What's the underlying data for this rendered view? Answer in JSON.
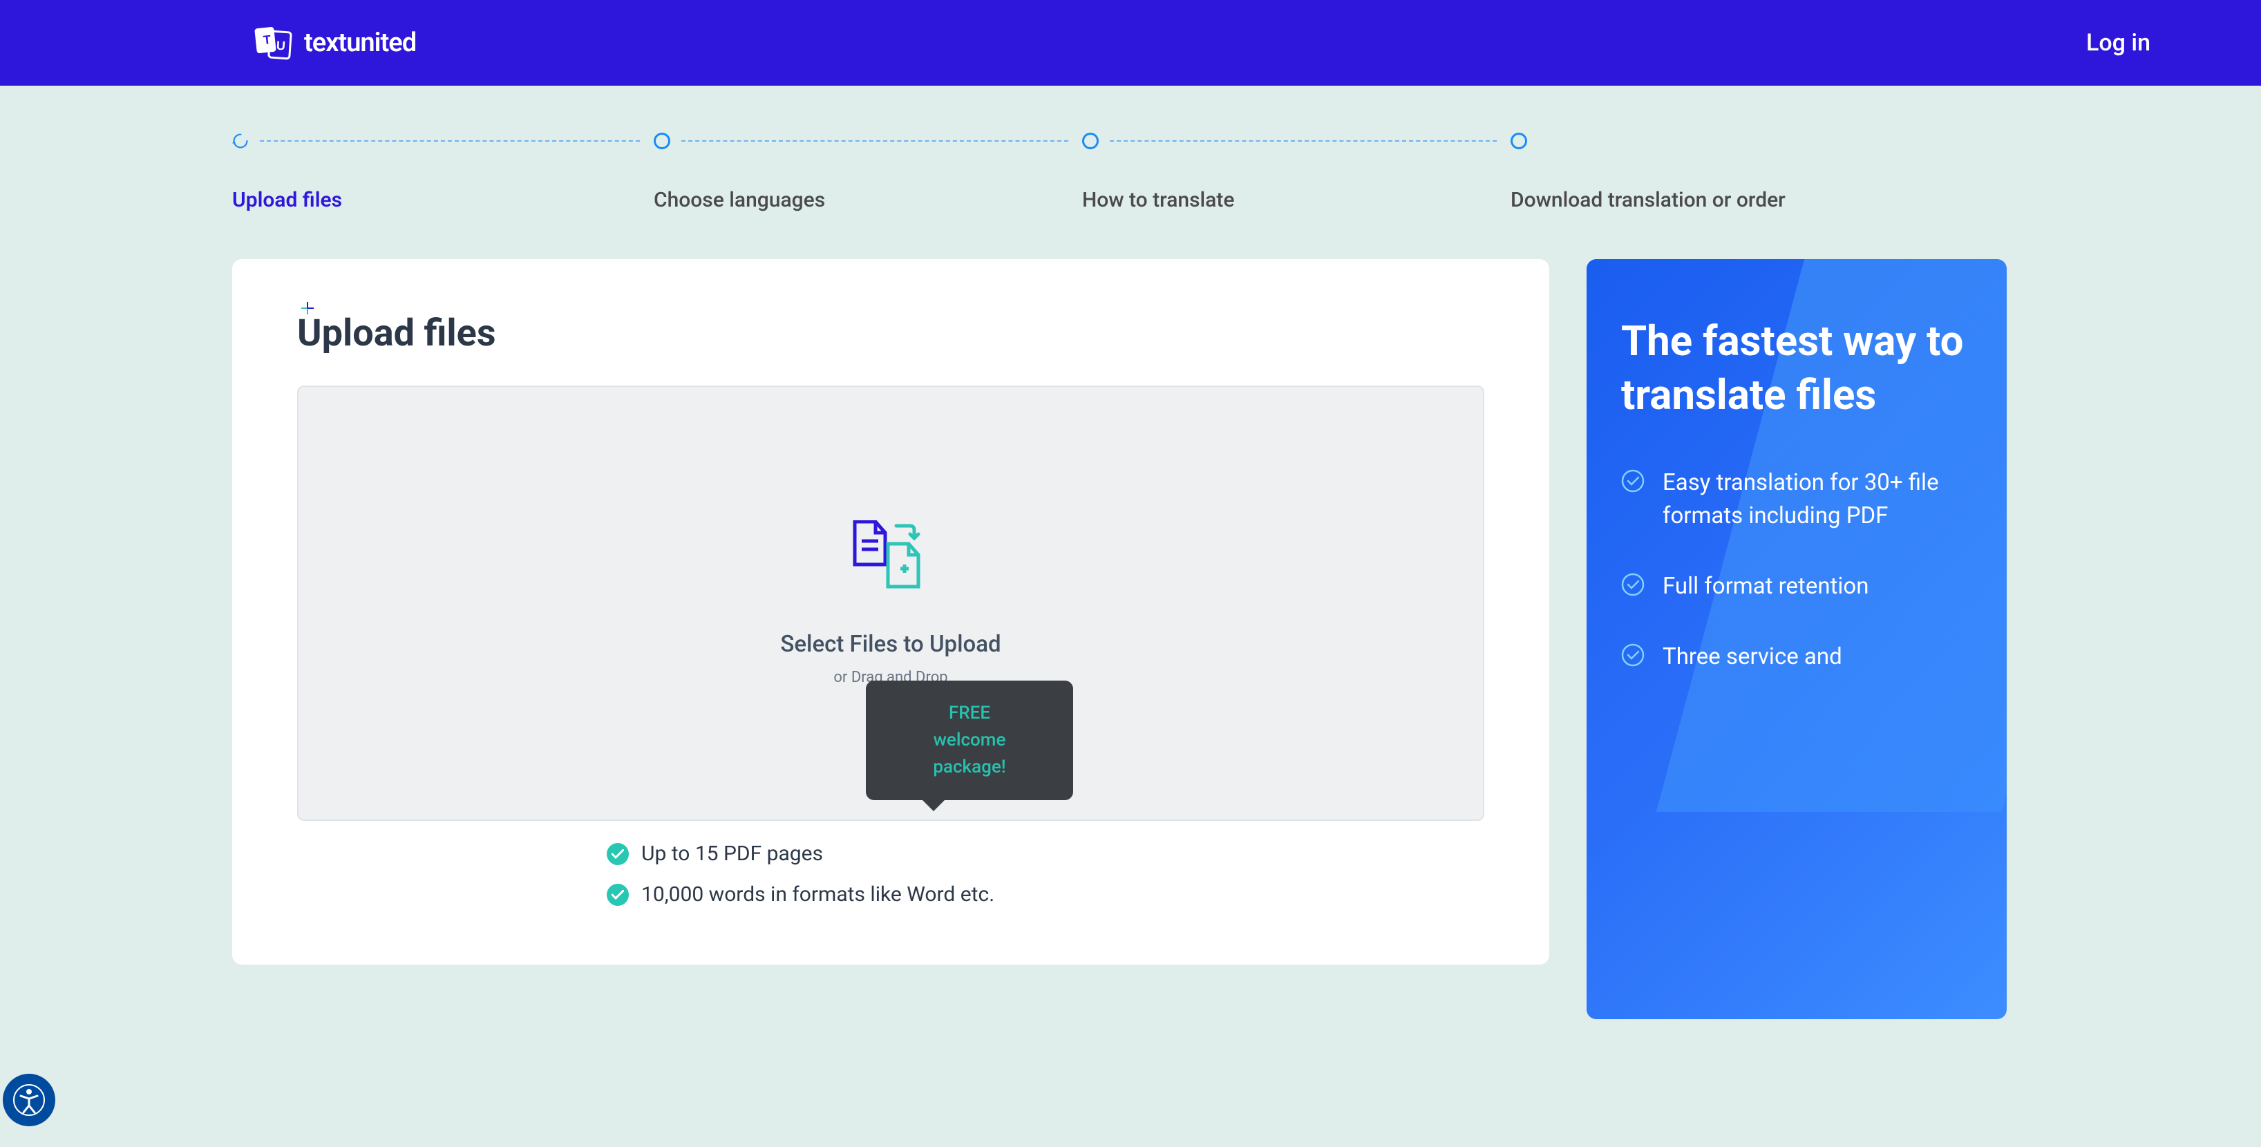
{
  "header": {
    "brand": "textunited",
    "login_label": "Log in"
  },
  "steps": [
    {
      "label": "Upload files",
      "active": true
    },
    {
      "label": "Choose languages",
      "active": false
    },
    {
      "label": "How to translate",
      "active": false
    },
    {
      "label": "Download translation or order",
      "active": false
    }
  ],
  "upload": {
    "title": "Upload files",
    "select_text": "Select Files to Upload",
    "drag_text": "or Drag and Drop",
    "features": [
      "Up to 15 PDF pages",
      "10,000 words in formats like Word etc."
    ]
  },
  "tooltip": {
    "line1": "FREE",
    "line2": "welcome",
    "line3": "package!"
  },
  "promo": {
    "title": "The fastest way to translate files",
    "items": [
      "Easy translation for 30+ file formats including PDF",
      "Full format retention",
      "Three service and"
    ]
  }
}
